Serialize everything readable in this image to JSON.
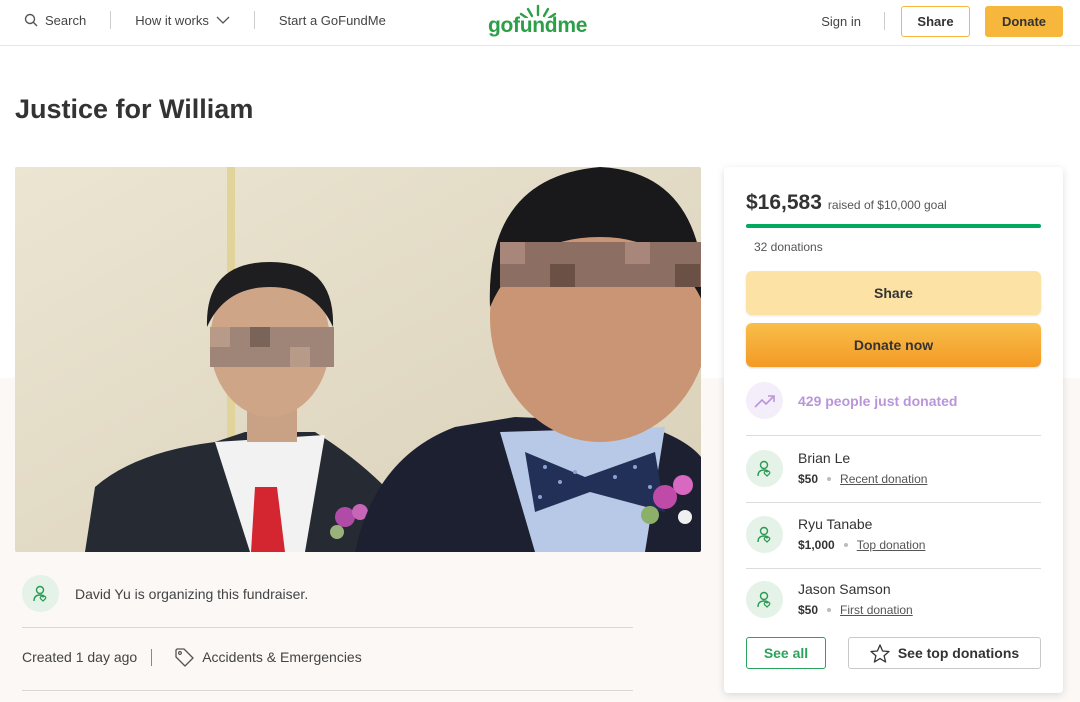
{
  "header": {
    "search_label": "Search",
    "how_it_works_label": "How it works",
    "start_label": "Start a GoFundMe",
    "logo_text": "gofundme",
    "signin_label": "Sign in",
    "share_label": "Share",
    "donate_label": "Donate"
  },
  "campaign": {
    "title": "Justice for William",
    "organizer_text": "David Yu is organizing this fundraiser.",
    "created_text": "Created 1 day ago",
    "category": "Accidents & Emergencies"
  },
  "donation_card": {
    "raised_amount": "$16,583",
    "goal_text": "raised of $10,000 goal",
    "progress_fraction": 1.0,
    "donations_count": "32 donations",
    "share_label": "Share",
    "donate_now_label": "Donate now",
    "trending_text": "429 people just donated",
    "donors": [
      {
        "name": "Brian Le",
        "amount": "$50",
        "kind": "Recent donation"
      },
      {
        "name": "Ryu Tanabe",
        "amount": "$1,000",
        "kind": "Top donation"
      },
      {
        "name": "Jason Samson",
        "amount": "$50",
        "kind": "First donation"
      }
    ],
    "see_all_label": "See all",
    "see_top_label": "See top donations"
  },
  "colors": {
    "brand_green": "#2d9f48",
    "donate_orange": "#f6b73c",
    "progress_green": "#02a95c",
    "trend_purple": "#b896d8"
  }
}
